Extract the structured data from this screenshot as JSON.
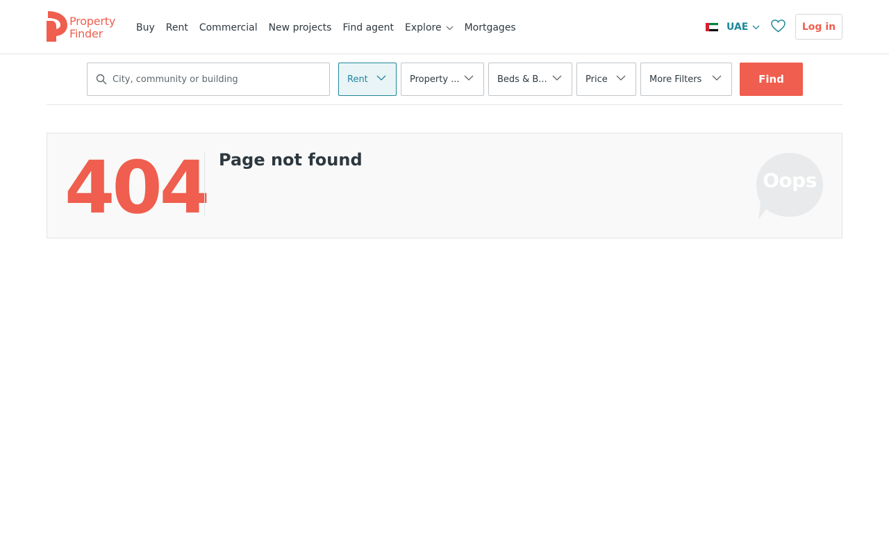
{
  "brand": {
    "line1": "Property",
    "line2": "Finder",
    "color": "#ef5e4e"
  },
  "nav": {
    "items": [
      {
        "label": "Buy"
      },
      {
        "label": "Rent"
      },
      {
        "label": "Commercial"
      },
      {
        "label": "New projects"
      },
      {
        "label": "Find agent"
      },
      {
        "label": "Explore",
        "dropdown": true
      },
      {
        "label": "Mortgages"
      }
    ]
  },
  "header": {
    "country": "UAE",
    "country_flag_icon": "uae-flag-icon",
    "favorites_icon": "heart-icon",
    "login_label": "Log in"
  },
  "search": {
    "placeholder": "City, community or building",
    "filters": [
      {
        "label": "Rent",
        "active": true
      },
      {
        "label": "Property ..."
      },
      {
        "label": "Beds & B..."
      },
      {
        "label": "Price"
      },
      {
        "label": "More Filters"
      }
    ],
    "find_label": "Find"
  },
  "error": {
    "code": "404",
    "title": "Page not found",
    "bubble_text": "Oops"
  },
  "colors": {
    "accent": "#ef5e4e",
    "teal": "#1e8799",
    "text": "#2d383f"
  }
}
